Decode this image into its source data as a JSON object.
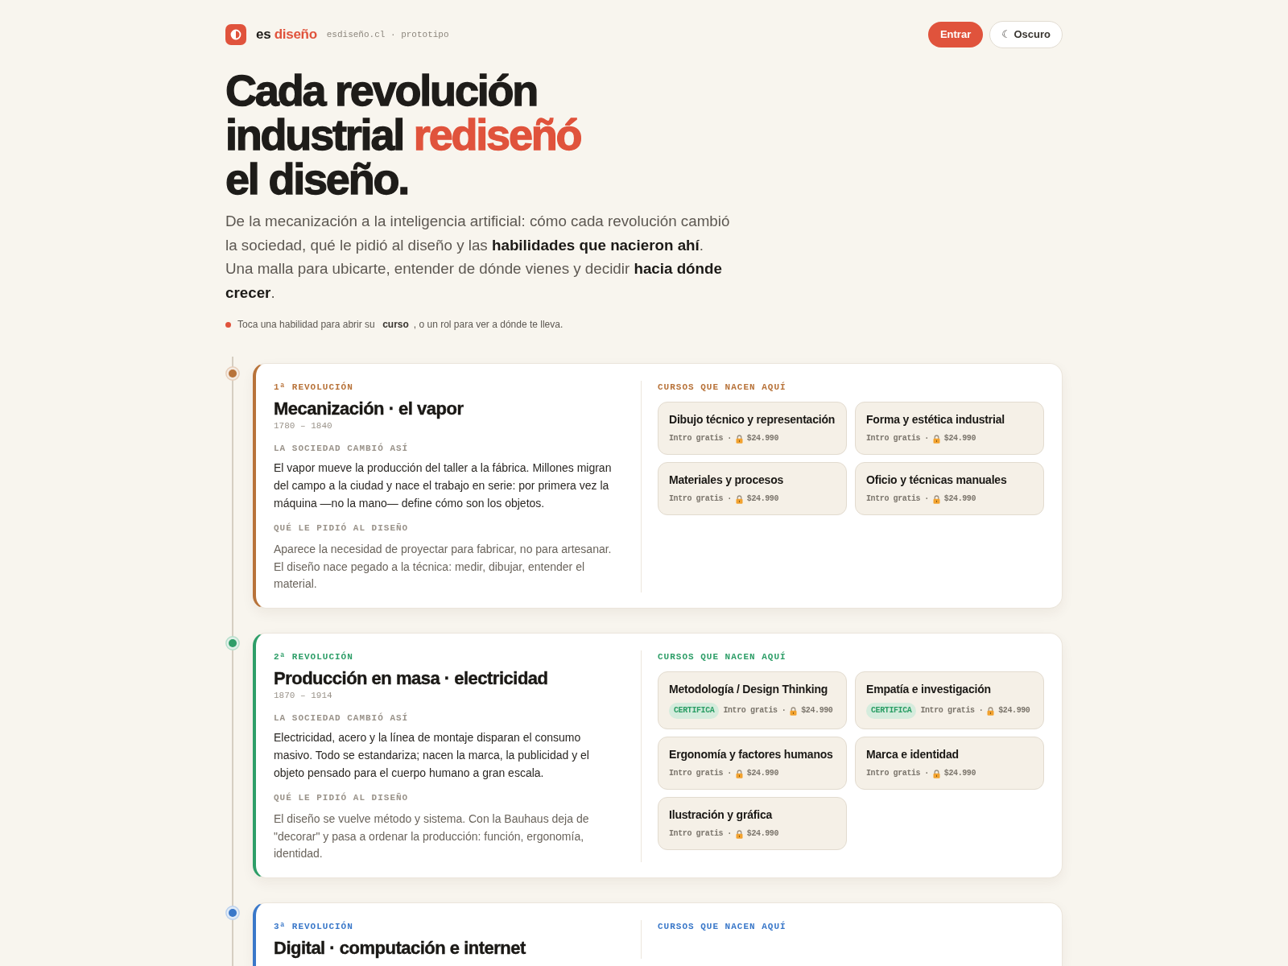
{
  "header": {
    "brand": {
      "prefix": "es",
      "name": "diseño"
    },
    "site": "esdiseño.cl · prototipo",
    "buttons": [
      {
        "label": "Entrar",
        "kind": "primary"
      },
      {
        "label": "☾ Oscuro",
        "kind": "outline"
      }
    ]
  },
  "hero": {
    "title_parts": [
      {
        "text": "Cada revolución industrial",
        "accent": false
      },
      {
        "text": "rediseñó",
        "accent": true
      },
      {
        "text": "el diseño.",
        "accent": false
      }
    ],
    "intro": "De la mecanización a la inteligencia artificial: cómo cada revolución cambió la sociedad, qué le pidió al diseño y las **habilidades que nacieron ahí**. Una malla para ubicarte, entender de dónde vienes y decidir **hacia dónde crecer**.",
    "hint": "Toca una habilidad para abrir su **curso**, o un rol para ver a dónde te lleva."
  },
  "revolutions": [
    {
      "number": "1ª REVOLUCIÓN",
      "color": "#b8733a",
      "title": "Mecanización · el vapor",
      "years": "1780 – 1840",
      "sections": [
        {
          "kind": "society",
          "label": "LA SOCIEDAD CAMBIÓ ASÍ",
          "text": "El vapor mueve la producción del taller a la fábrica. Millones migran del campo a la ciudad y nace el trabajo en serie: por primera vez la máquina —no la mano— define cómo son los objetos."
        },
        {
          "kind": "design",
          "label": "QUÉ LE PIDIÓ AL DISEÑO",
          "text": "Aparece la necesidad de proyectar para fabricar, no para artesanar. El diseño nace pegado a la técnica: medir, dibujar, entender el material."
        }
      ],
      "courses_label": "CURSOS QUE NACEN AQUÍ",
      "courses": [
        {
          "title": "Dibujo técnico y representación",
          "free_label": "Intro gratis",
          "separator": "·",
          "price": "$24.990"
        },
        {
          "title": "Forma y estética industrial",
          "free_label": "Intro gratis",
          "separator": "·",
          "price": "$24.990"
        },
        {
          "title": "Materiales y procesos",
          "free_label": "Intro gratis",
          "separator": "·",
          "price": "$24.990"
        },
        {
          "title": "Oficio y técnicas manuales",
          "free_label": "Intro gratis",
          "separator": "·",
          "price": "$24.990"
        }
      ]
    },
    {
      "number": "2ª REVOLUCIÓN",
      "color": "#2e9e68",
      "title": "Producción en masa · electricidad",
      "years": "1870 – 1914",
      "sections": [
        {
          "kind": "society",
          "label": "LA SOCIEDAD CAMBIÓ ASÍ",
          "text": "Electricidad, acero y la línea de montaje disparan el consumo masivo. Todo se estandariza; nacen la marca, la publicidad y el objeto pensado para el cuerpo humano a gran escala."
        },
        {
          "kind": "design",
          "label": "QUÉ LE PIDIÓ AL DISEÑO",
          "text": "El diseño se vuelve método y sistema. Con la Bauhaus deja de \"decorar\" y pasa a ordenar la producción: función, ergonomía, identidad."
        }
      ],
      "courses_label": "CURSOS QUE NACEN AQUÍ",
      "courses": [
        {
          "title": "Metodología / Design Thinking",
          "badge": "CERTIFICA",
          "free_label": "Intro gratis",
          "separator": "·",
          "price": "$24.990"
        },
        {
          "title": "Empatía e investigación",
          "badge": "CERTIFICA",
          "free_label": "Intro gratis",
          "separator": "·",
          "price": "$24.990"
        },
        {
          "title": "Ergonomía y factores humanos",
          "free_label": "Intro gratis",
          "separator": "·",
          "price": "$24.990"
        },
        {
          "title": "Marca e identidad",
          "free_label": "Intro gratis",
          "separator": "·",
          "price": "$24.990"
        },
        {
          "title": "Ilustración y gráfica",
          "free_label": "Intro gratis",
          "separator": "·",
          "price": "$24.990"
        }
      ]
    },
    {
      "number": "3ª REVOLUCIÓN",
      "color": "#3a78c9",
      "title": "Digital · computación e internet",
      "courses_label": "CURSOS QUE NACEN AQUÍ"
    }
  ]
}
